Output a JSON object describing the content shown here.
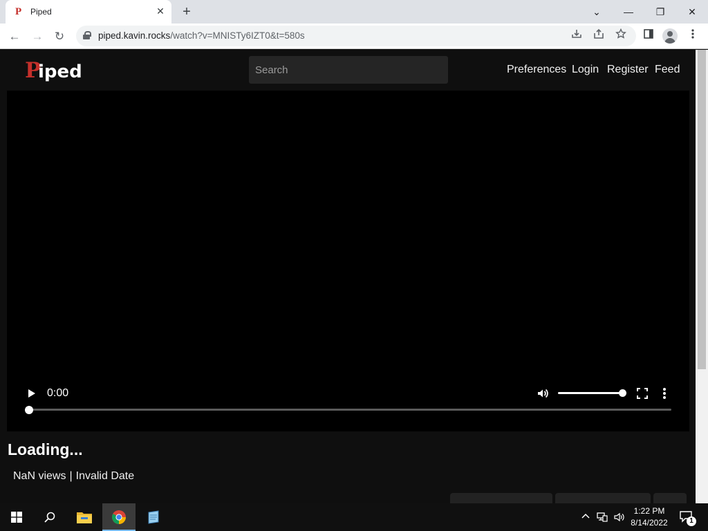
{
  "browser": {
    "tab_title": "Piped",
    "tab_favicon": "P",
    "tab_close": "✕",
    "new_tab": "+",
    "window_controls": {
      "dropdown": "⌄",
      "minimize": "—",
      "restore": "❐",
      "close": "✕"
    },
    "url_host": "piped.kavin.rocks",
    "url_path": "/watch?v=MNISTy6IZT0&t=580s",
    "nav": {
      "back": "←",
      "forward": "→",
      "reload": "↻"
    }
  },
  "site": {
    "logo_first_letter": "P",
    "logo_rest": "iped",
    "search_placeholder": "Search",
    "nav_links": [
      "Preferences",
      "Login",
      "Register",
      "Feed"
    ],
    "accent_color": "#c4302b"
  },
  "player": {
    "time": "0:00",
    "volume_level": 1.0,
    "progress": 0.0
  },
  "video": {
    "title": "Loading...",
    "views": "NaN views",
    "separator": "|",
    "date": "Invalid Date"
  },
  "taskbar": {
    "apps": [
      "start-icon",
      "search-icon",
      "file-explorer-icon",
      "chrome-icon",
      "notepad-icon"
    ],
    "time": "1:22 PM",
    "date": "8/14/2022",
    "notification_count": "1"
  }
}
